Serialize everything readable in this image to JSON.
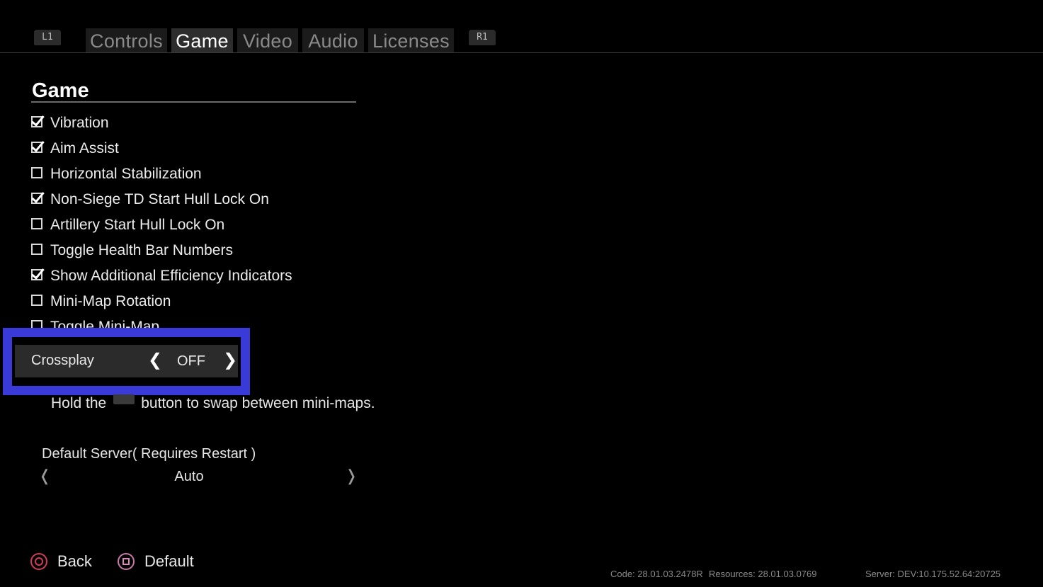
{
  "tabbar": {
    "left_shoulder": "L1",
    "right_shoulder": "R1",
    "tabs": [
      {
        "label": "Controls",
        "active": false
      },
      {
        "label": "Game",
        "active": true
      },
      {
        "label": "Video",
        "active": false
      },
      {
        "label": "Audio",
        "active": false
      },
      {
        "label": "Licenses",
        "active": false
      }
    ]
  },
  "section": {
    "title": "Game",
    "options": [
      {
        "label": "Vibration",
        "checked": true
      },
      {
        "label": "Aim Assist",
        "checked": true
      },
      {
        "label": "Horizontal Stabilization",
        "checked": false
      },
      {
        "label": "Non-Siege TD Start Hull Lock On",
        "checked": true
      },
      {
        "label": "Artillery Start Hull Lock On",
        "checked": false
      },
      {
        "label": "Toggle Health Bar Numbers",
        "checked": false
      },
      {
        "label": "Show Additional Efficiency Indicators",
        "checked": true
      },
      {
        "label": "Mini-Map Rotation",
        "checked": false
      },
      {
        "label": "Toggle Mini-Map",
        "checked": false
      }
    ]
  },
  "crossplay": {
    "label": "Crossplay",
    "value": "OFF",
    "prev_glyph": "❮",
    "next_glyph": "❯",
    "focus_color": "#3a3ad8"
  },
  "hint": {
    "before": "Hold the",
    "after": "button to swap between mini-maps."
  },
  "server": {
    "label": "Default Server( Requires Restart )",
    "value": "Auto",
    "prev_glyph": "❬",
    "next_glyph": "❭"
  },
  "footer": {
    "back_label": "Back",
    "default_label": "Default",
    "back_icon": "circle-button-icon",
    "default_icon": "square-button-icon"
  },
  "version": {
    "code": "Code: 28.01.03.2478R",
    "resources": "Resources: 28.01.03.0769",
    "server": "Server:  DEV:10.175.52.64:20725"
  }
}
